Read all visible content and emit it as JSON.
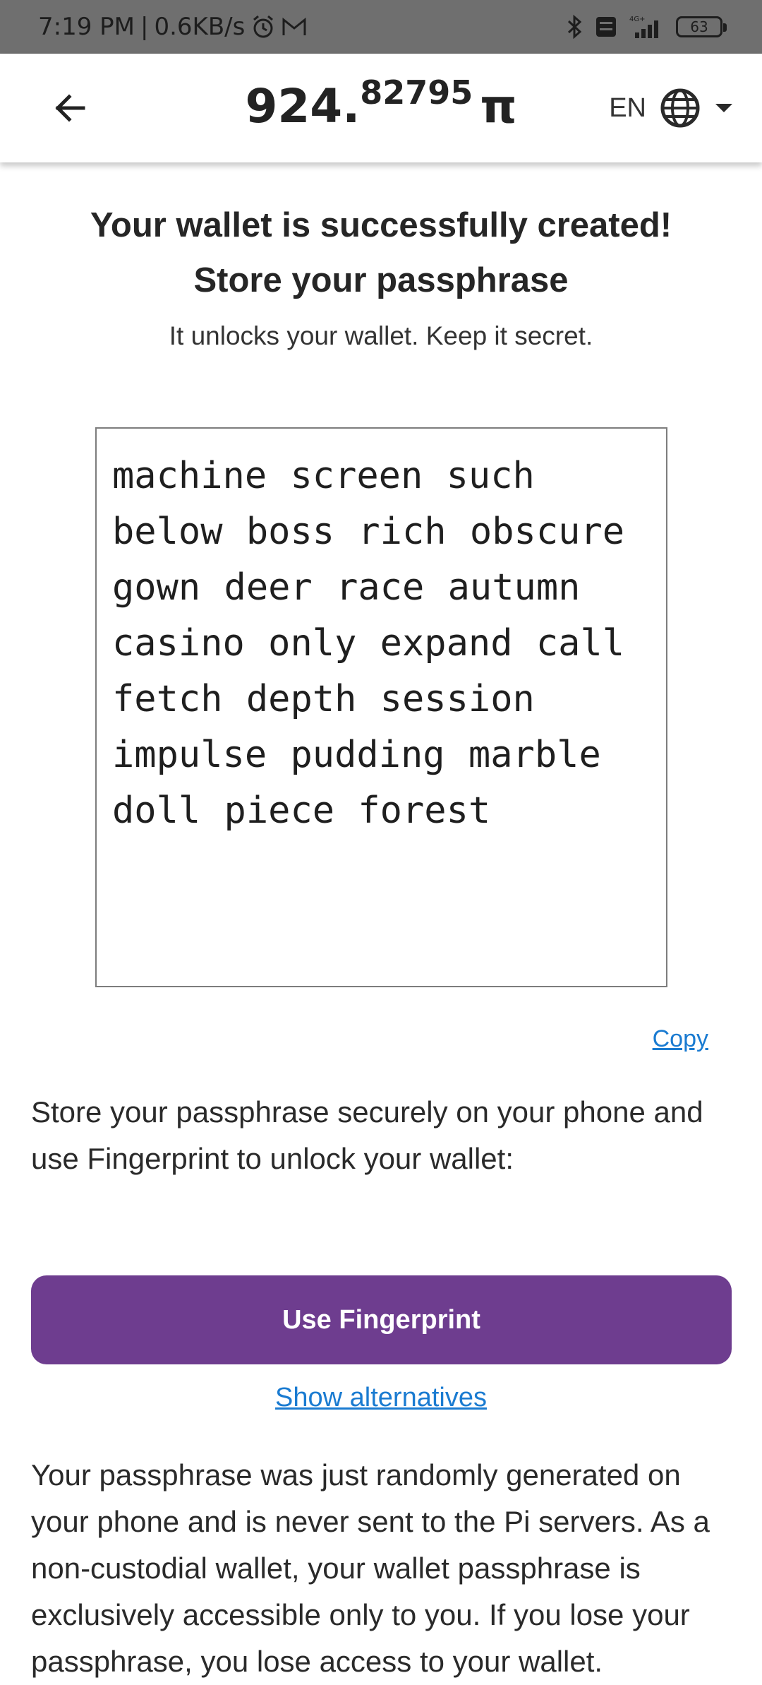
{
  "status_bar": {
    "time": "7:19 PM",
    "separator": "|",
    "speed": "0.6KB/s",
    "network": "4G+",
    "battery": "63",
    "icons": [
      "alarm-icon",
      "gmail-icon",
      "bluetooth-icon",
      "volte-icon",
      "signal-icon",
      "battery-icon"
    ]
  },
  "app_bar": {
    "balance_int": "924.",
    "balance_frac": "82795",
    "balance_symbol": "π",
    "language": "EN"
  },
  "content": {
    "heading_line1": "Your wallet is successfully created!",
    "heading_line2": "Store your passphrase",
    "subheading": "It unlocks your wallet. Keep it secret.",
    "passphrase": "machine screen such below boss rich obscure gown deer race autumn casino only expand call fetch depth session impulse pudding marble doll piece forest",
    "copy_label": "Copy",
    "store_text": "Store your passphrase securely on your phone and use Fingerprint to unlock your wallet:",
    "fingerprint_button": "Use Fingerprint",
    "alternatives_link": "Show alternatives",
    "info_text": "Your passphrase was just randomly generated on your phone and is never sent to the Pi servers. As a non-custodial wallet, your wallet passphrase is exclusively accessible only to you. If you lose your passphrase, you lose access to your wallet."
  },
  "colors": {
    "accent": "#6e3d8f",
    "link": "#1a7bd1",
    "status_bar": "#6f6f6f"
  }
}
